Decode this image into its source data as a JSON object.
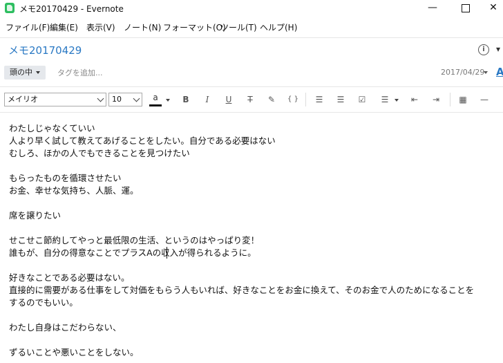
{
  "window": {
    "title": "メモ20170429 - Evernote"
  },
  "menu": [
    "ファイル(F)",
    "編集(E)",
    "表示(V)",
    "ノート(N)",
    "フォーマット(O)",
    "ツール(T)",
    "ヘルプ(H)"
  ],
  "note": {
    "title": "メモ20170429",
    "notebook": "頭の中",
    "tag_placeholder": "タグを追加...",
    "date": "2017/04/29"
  },
  "toolbar": {
    "font": "メイリオ",
    "size": "10",
    "color_letter": "a",
    "bold": "B",
    "italic": "I",
    "underline": "U",
    "strikethrough": "T",
    "code": "{ }"
  },
  "body_lines": [
    "わたしじゃなくていい",
    "人より早く試して教えてあげることをしたい。自分である必要はない",
    "むしろ、ほかの人でもできることを見つけたい",
    "",
    "もらったものを循環させたい",
    "お金、幸せな気持ち、人脈、運。",
    "",
    "席を譲りたい",
    "",
    "せこせこ節約してやっと最低限の生活、というのはやっぱり変！",
    "誰もが、自分の得意なことでプラスAの収入が得られるように。",
    "",
    "好きなことである必要はない。",
    "直接的に需要がある仕事をして対価をもらう人もいれば、好きなことをお金に換えて、そのお金で人のためになることを",
    "するのでもいい。",
    "",
    "わたし自身はこだわらない、",
    "",
    "ずるいことや悪いことをしない。"
  ],
  "icons": {
    "app": "evernote-icon",
    "info": "info-icon",
    "more": "more-icon"
  },
  "colors": {
    "accent": "#2a79c4",
    "notebook_bg": "#e5e8ec"
  }
}
